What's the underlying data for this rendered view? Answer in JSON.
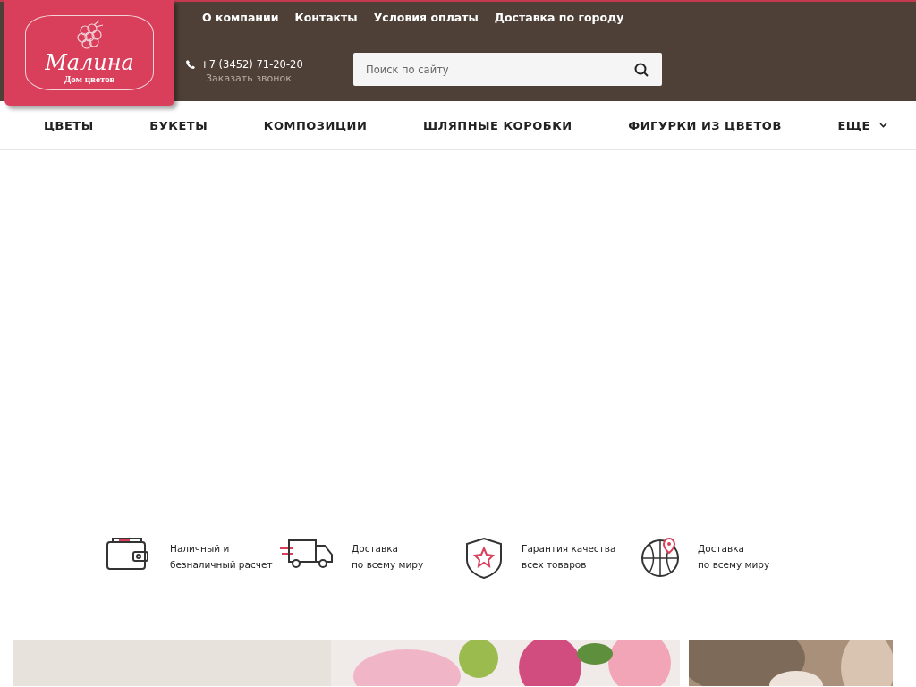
{
  "logo": {
    "title": "Малина",
    "subtitle": "Дом цветов"
  },
  "top_links": [
    "О компании",
    "Контакты",
    "Условия оплаты",
    "Доставка по городу"
  ],
  "phone": {
    "number": "+7 (3452) 71-20-20",
    "callback": "Заказать звонок"
  },
  "search": {
    "placeholder": "Поиск по сайту"
  },
  "nav": [
    {
      "label": "ЦВЕТЫ",
      "dropdown": false
    },
    {
      "label": "БУКЕТЫ",
      "dropdown": false
    },
    {
      "label": "КОМПОЗИЦИИ",
      "dropdown": false
    },
    {
      "label": "ШЛЯПНЫЕ КОРОБКИ",
      "dropdown": false
    },
    {
      "label": "ФИГУРКИ ИЗ ЦВЕТОВ",
      "dropdown": false
    },
    {
      "label": "ЕЩЕ",
      "dropdown": true
    }
  ],
  "features": [
    {
      "kind": "wallet",
      "lines": [
        "Наличный и",
        "безналичный расчет"
      ]
    },
    {
      "kind": "truck",
      "lines": [
        "Доставка",
        "по всему миру"
      ]
    },
    {
      "kind": "shield",
      "lines": [
        "Гарантия качества",
        "всех товаров"
      ]
    },
    {
      "kind": "globe",
      "lines": [
        "Доставка",
        "по всему миру"
      ]
    }
  ]
}
